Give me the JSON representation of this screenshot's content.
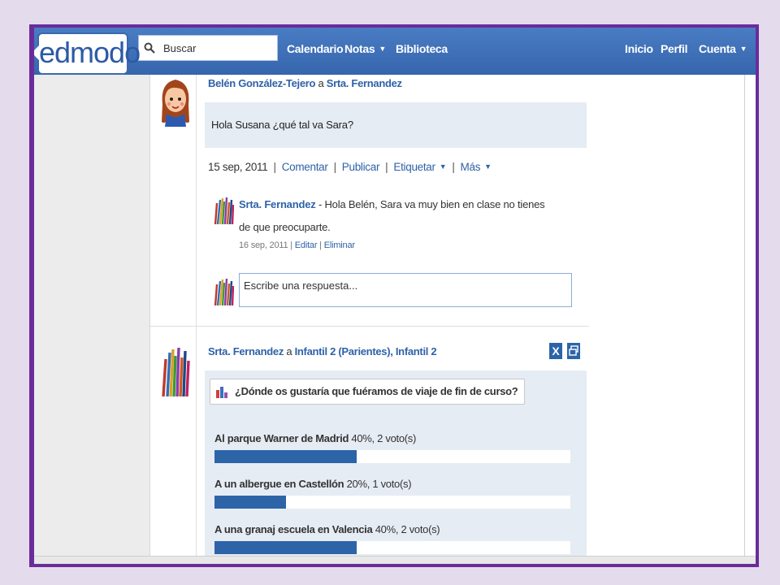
{
  "nav": {
    "logo": "edmodo",
    "search_placeholder": "Buscar",
    "left_links": [
      {
        "label": "Calendario"
      },
      {
        "label": "Notas",
        "dropdown": true
      },
      {
        "label": "Biblioteca"
      }
    ],
    "right_links": [
      {
        "label": "Inicio"
      },
      {
        "label": "Perfil"
      },
      {
        "label": "Cuenta",
        "dropdown": true
      }
    ]
  },
  "post1": {
    "author": "Belén González-Tejero",
    "connector": "a",
    "recipient": "Srta. Fernandez",
    "message": "Hola Susana ¿qué tal va Sara?",
    "date": "15 sep, 2011",
    "actions": [
      "Comentar",
      "Publicar",
      "Etiquetar",
      "Más"
    ],
    "reply": {
      "author": "Srta. Fernandez",
      "text": " - Hola Belén, Sara va muy bien en clase no tienes de que preocuparte.",
      "date": "16 sep, 2011",
      "edit": "Editar",
      "delete": "Eliminar"
    },
    "reply_placeholder": "Escribe una respuesta..."
  },
  "post2": {
    "author": "Srta. Fernandez",
    "connector": "a",
    "groups": "Infantil 2 (Parientes), Infantil 2",
    "close_label": "X",
    "poll": {
      "question": "¿Dónde os gustaría que fuéramos de viaje de fin de curso?",
      "options": [
        {
          "name": "Al parque Warner de Madrid",
          "result": "40%, 2 voto(s)",
          "percent": 40
        },
        {
          "name": "A un albergue en Castellón",
          "result": "20%, 1 voto(s)",
          "percent": 20
        },
        {
          "name": "A una granaj escuela en Valencia",
          "result": "40%, 2 voto(s)",
          "percent": 40
        }
      ]
    }
  },
  "colors": {
    "nav_bar": "#3566ad",
    "link": "#2f62a8",
    "poll_bar": "#2d64a8",
    "frame": "#6a2c9a"
  }
}
